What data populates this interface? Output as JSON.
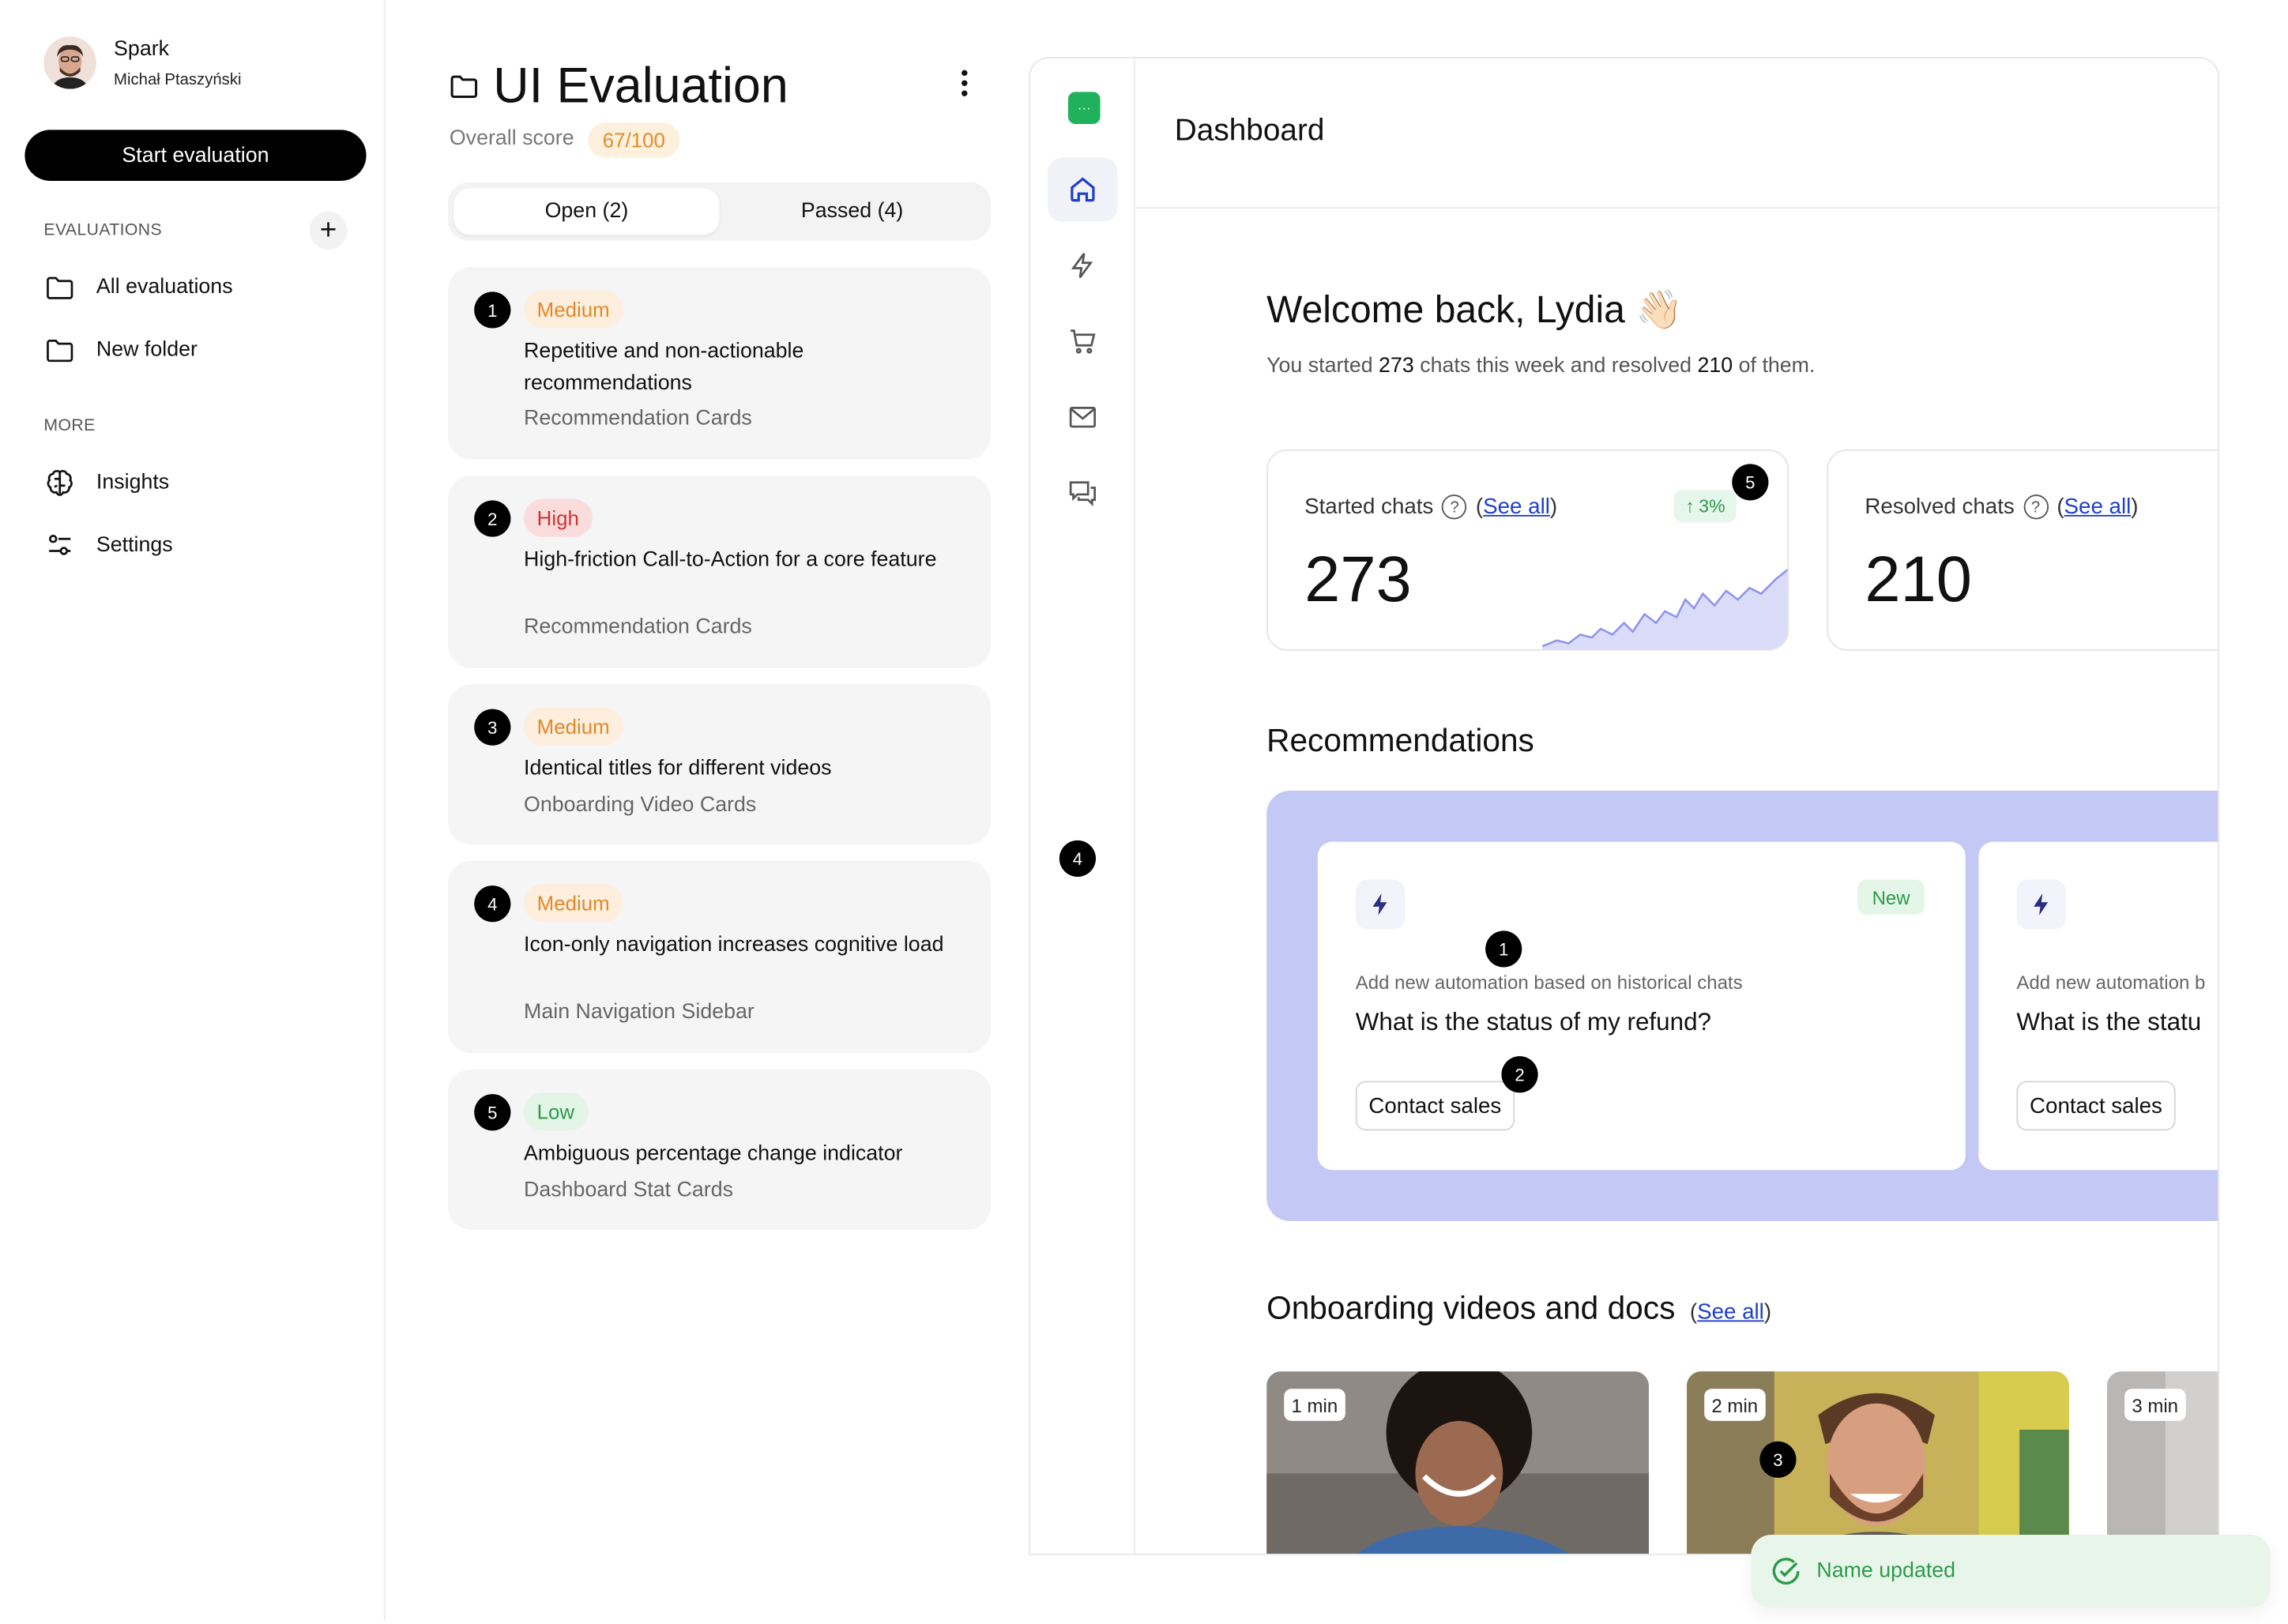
{
  "user": {
    "name": "Spark",
    "subtitle": "Michał Ptaszyński"
  },
  "start_button": "Start evaluation",
  "sidebar": {
    "evaluations_header": "EVALUATIONS",
    "items": [
      {
        "label": "All evaluations",
        "icon": "folder-icon"
      },
      {
        "label": "New folder",
        "icon": "folder-icon"
      }
    ],
    "more_header": "MORE",
    "more_items": [
      {
        "label": "Insights",
        "icon": "brain-icon"
      },
      {
        "label": "Settings",
        "icon": "sliders-icon"
      }
    ]
  },
  "evaluation": {
    "title": "UI Evaluation",
    "score_label": "Overall score",
    "score": "67/100",
    "tabs": [
      {
        "label": "Open (2)",
        "active": true
      },
      {
        "label": "Passed (4)",
        "active": false
      }
    ],
    "issues": [
      {
        "num": "1",
        "severity": "Medium",
        "title": "Repetitive and non-actionable recommendations",
        "component": "Recommendation Cards"
      },
      {
        "num": "2",
        "severity": "High",
        "title": "High-friction Call-to-Action for a core feature",
        "component": "Recommendation Cards"
      },
      {
        "num": "3",
        "severity": "Medium",
        "title": "Identical titles for different videos",
        "component": "Onboarding Video Cards"
      },
      {
        "num": "4",
        "severity": "Medium",
        "title": "Icon-only navigation increases cognitive load",
        "component": "Main Navigation Sidebar"
      },
      {
        "num": "5",
        "severity": "Low",
        "title": "Ambiguous percentage change indicator",
        "component": "Dashboard Stat Cards"
      }
    ]
  },
  "preview": {
    "header_title": "Dashboard",
    "rail_icons": [
      "home-icon",
      "bolt-icon",
      "cart-icon",
      "mail-icon",
      "chat-icon"
    ],
    "welcome": "Welcome back, Lydia 👋🏻",
    "summary": {
      "prefix": "You started ",
      "started": "273",
      "middle": " chats this week and resolved ",
      "resolved": "210",
      "suffix": " of them."
    },
    "stats": [
      {
        "label": "Started chats",
        "see_all": "See all",
        "value": "273",
        "delta": "3%"
      },
      {
        "label": "Resolved chats",
        "see_all": "See all",
        "value": "210"
      }
    ],
    "recommendations_title": "Recommendations",
    "recommendations": [
      {
        "badge": "New",
        "subtitle": "Add new automation based on historical chats",
        "title": "What is the status of my refund?",
        "button": "Contact sales"
      },
      {
        "subtitle": "Add new automation b",
        "title": "What is the statu",
        "button": "Contact sales"
      }
    ],
    "onboarding_title": "Onboarding videos and docs",
    "onboarding_see_all": "See all",
    "videos": [
      {
        "duration": "1 min"
      },
      {
        "duration": "2 min"
      },
      {
        "duration": "3 min"
      }
    ],
    "markers": [
      "1",
      "2",
      "3",
      "4",
      "5"
    ]
  },
  "toast": "Name updated",
  "colors": {
    "accent": "#000000",
    "medium": "#e0892a",
    "high": "#c93434",
    "low": "#2f9a4c",
    "link": "#1f3ec9",
    "rec_bg": "#c4c8f5"
  }
}
